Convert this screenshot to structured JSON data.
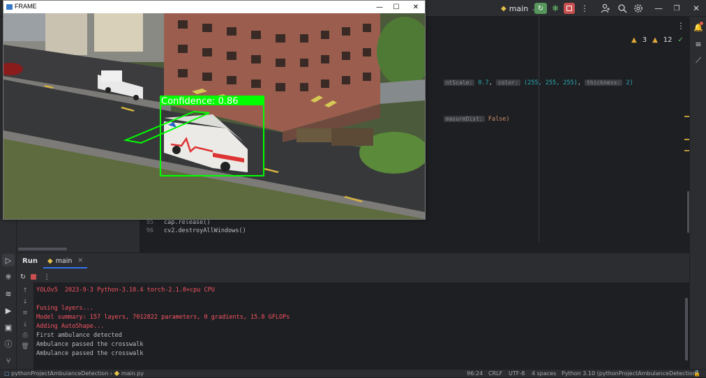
{
  "titlebar": {
    "branch_label": "main",
    "icons": [
      "python-icon",
      "run-icon",
      "debug-icon",
      "stop-icon",
      "more-icon",
      "add-user-icon",
      "search-icon",
      "settings-icon",
      "minimize-icon",
      "maximize-icon",
      "close-icon"
    ]
  },
  "editor": {
    "inspections": {
      "warnings_a": "3",
      "warnings_b": "12",
      "ok": "1"
    },
    "line1": {
      "hint1": "ntScale:",
      "v1": "0.7",
      "hint2": "color:",
      "v2": "(255, 255, 255)",
      "hint3": "thickness:",
      "v3": "2)"
    },
    "line2": {
      "hint": "easureDist:",
      "value": "False)"
    },
    "line95": {
      "num": "95",
      "code": "cap.release()"
    },
    "line96": {
      "num": "96",
      "code": "cv2.destroyAllWindows()"
    }
  },
  "run": {
    "title": "Run",
    "tab_label": "main",
    "console": [
      {
        "text": "YOLOv5  2023-9-3 Python-3.10.4 torch-2.1.0+cpu CPU",
        "color": "red"
      },
      {
        "text": "Fusing layers...",
        "color": "red"
      },
      {
        "text": "Model summary: 157 layers, 7012822 parameters, 0 gradients, 15.8 GFLOPs",
        "color": "red"
      },
      {
        "text": "Adding AutoShape...",
        "color": "red"
      },
      {
        "text": "First ambulance detected",
        "color": "white"
      },
      {
        "text": "Ambulance passed the crosswalk",
        "color": "white"
      },
      {
        "text": "Ambulance passed the crosswalk",
        "color": "white"
      }
    ]
  },
  "statusbar": {
    "project": "pythonProjectAmbulanceDetection",
    "file": "main.py",
    "position": "96:24",
    "line_sep": "CRLF",
    "encoding": "UTF-8",
    "indent": "4 spaces",
    "interpreter": "Python 3.10 (pythonProjectAmbulanceDetection)"
  },
  "frame_window": {
    "title": "FRAME",
    "detection_label": "Confidence: 0.86",
    "box_color": "#00ff00"
  },
  "colors": {
    "accent": "#3574f0",
    "error_text": "#f75464",
    "run_green": "#57965c",
    "stop_red": "#c94f4f"
  }
}
